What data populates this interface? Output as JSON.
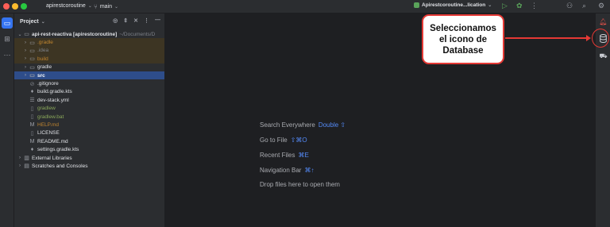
{
  "titlebar": {
    "project_name": "apirestcoroutine",
    "branch": "main",
    "run_config": "Apirestcoroutine...lication"
  },
  "project_panel": {
    "title": "Project",
    "tree": [
      {
        "label": "api-rest-reactiva [apirestcoroutine]",
        "suffix": "~/Documents/D",
        "arrow": "⌄",
        "icon": "module",
        "indent": 0,
        "style": "bold"
      },
      {
        "label": ".gradle",
        "arrow": "›",
        "icon": "folder",
        "indent": 1,
        "style": "excluded"
      },
      {
        "label": ".idea",
        "arrow": "›",
        "icon": "folder",
        "indent": 1,
        "style": "excluded-plain"
      },
      {
        "label": "build",
        "arrow": "›",
        "icon": "folder",
        "indent": 1,
        "style": "excluded"
      },
      {
        "label": "gradle",
        "arrow": "›",
        "icon": "folder",
        "indent": 1,
        "style": "normal"
      },
      {
        "label": "src",
        "arrow": "›",
        "icon": "folder",
        "indent": 1,
        "style": "selected"
      },
      {
        "label": ".gitignore",
        "arrow": "",
        "icon": "ignore",
        "indent": 2,
        "style": "normal"
      },
      {
        "label": "build.gradle.kts",
        "arrow": "",
        "icon": "gradle",
        "indent": 2,
        "style": "normal"
      },
      {
        "label": "dev-stack.yml",
        "arrow": "",
        "icon": "yaml",
        "indent": 2,
        "style": "normal"
      },
      {
        "label": "gradlew",
        "arrow": "",
        "icon": "file",
        "indent": 2,
        "style": "green"
      },
      {
        "label": "gradlew.bat",
        "arrow": "",
        "icon": "file",
        "indent": 2,
        "style": "green"
      },
      {
        "label": "HELP.md",
        "arrow": "",
        "icon": "md",
        "indent": 2,
        "style": "orange"
      },
      {
        "label": "LICENSE",
        "arrow": "",
        "icon": "file",
        "indent": 2,
        "style": "normal"
      },
      {
        "label": "README.md",
        "arrow": "",
        "icon": "md",
        "indent": 2,
        "style": "normal"
      },
      {
        "label": "settings.gradle.kts",
        "arrow": "",
        "icon": "gradle",
        "indent": 2,
        "style": "normal"
      },
      {
        "label": "External Libraries",
        "arrow": "›",
        "icon": "libs",
        "indent": 0,
        "style": "normal"
      },
      {
        "label": "Scratches and Consoles",
        "arrow": "›",
        "icon": "scratch",
        "indent": 0,
        "style": "normal"
      }
    ]
  },
  "editor_hints": [
    {
      "label": "Search Everywhere",
      "shortcut": "Double ⇧"
    },
    {
      "label": "Go to File",
      "shortcut": "⇧⌘O"
    },
    {
      "label": "Recent Files",
      "shortcut": "⌘E"
    },
    {
      "label": "Navigation Bar",
      "shortcut": "⌘↑"
    },
    {
      "label": "Drop files here to open them",
      "shortcut": ""
    }
  ],
  "callout": {
    "lines": [
      "Seleccionamos",
      "el icono de",
      "Database"
    ]
  },
  "colors": {
    "accent": "#3574f0",
    "annotation_red": "#e53935"
  }
}
